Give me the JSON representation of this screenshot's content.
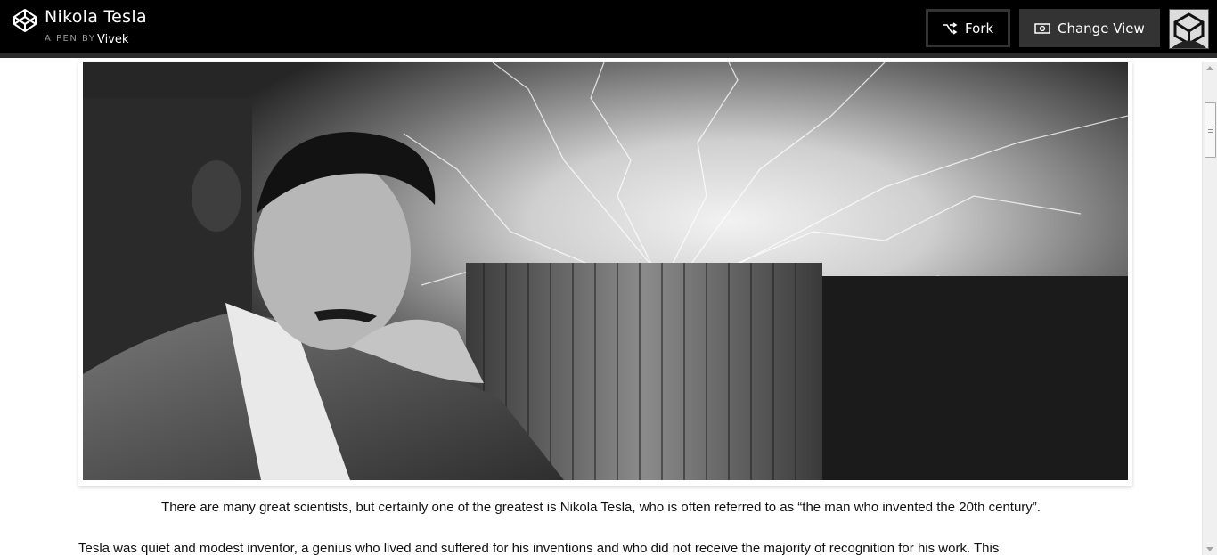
{
  "header": {
    "title": "Nikola Tesla",
    "byline_prefix": "A PEN BY",
    "author": "Vivek",
    "fork_label": "Fork",
    "change_view_label": "Change View",
    "logo_icon": "codepen-logo-icon",
    "avatar_icon": "user-avatar-icon"
  },
  "article": {
    "hero_alt": "Nikola Tesla",
    "caption": "There are many great scientists, but certainly one of the greatest is Nikola Tesla, who is often referred to as “the man who invented the 20th century”.",
    "paragraph": "Tesla was quiet and modest inventor, a genius who lived and suffered for his inventions and who did not receive the majority of recognition for his work. This"
  },
  "colors": {
    "topbar_bg": "#000000",
    "button_bg": "#333333",
    "text": "#111111"
  }
}
